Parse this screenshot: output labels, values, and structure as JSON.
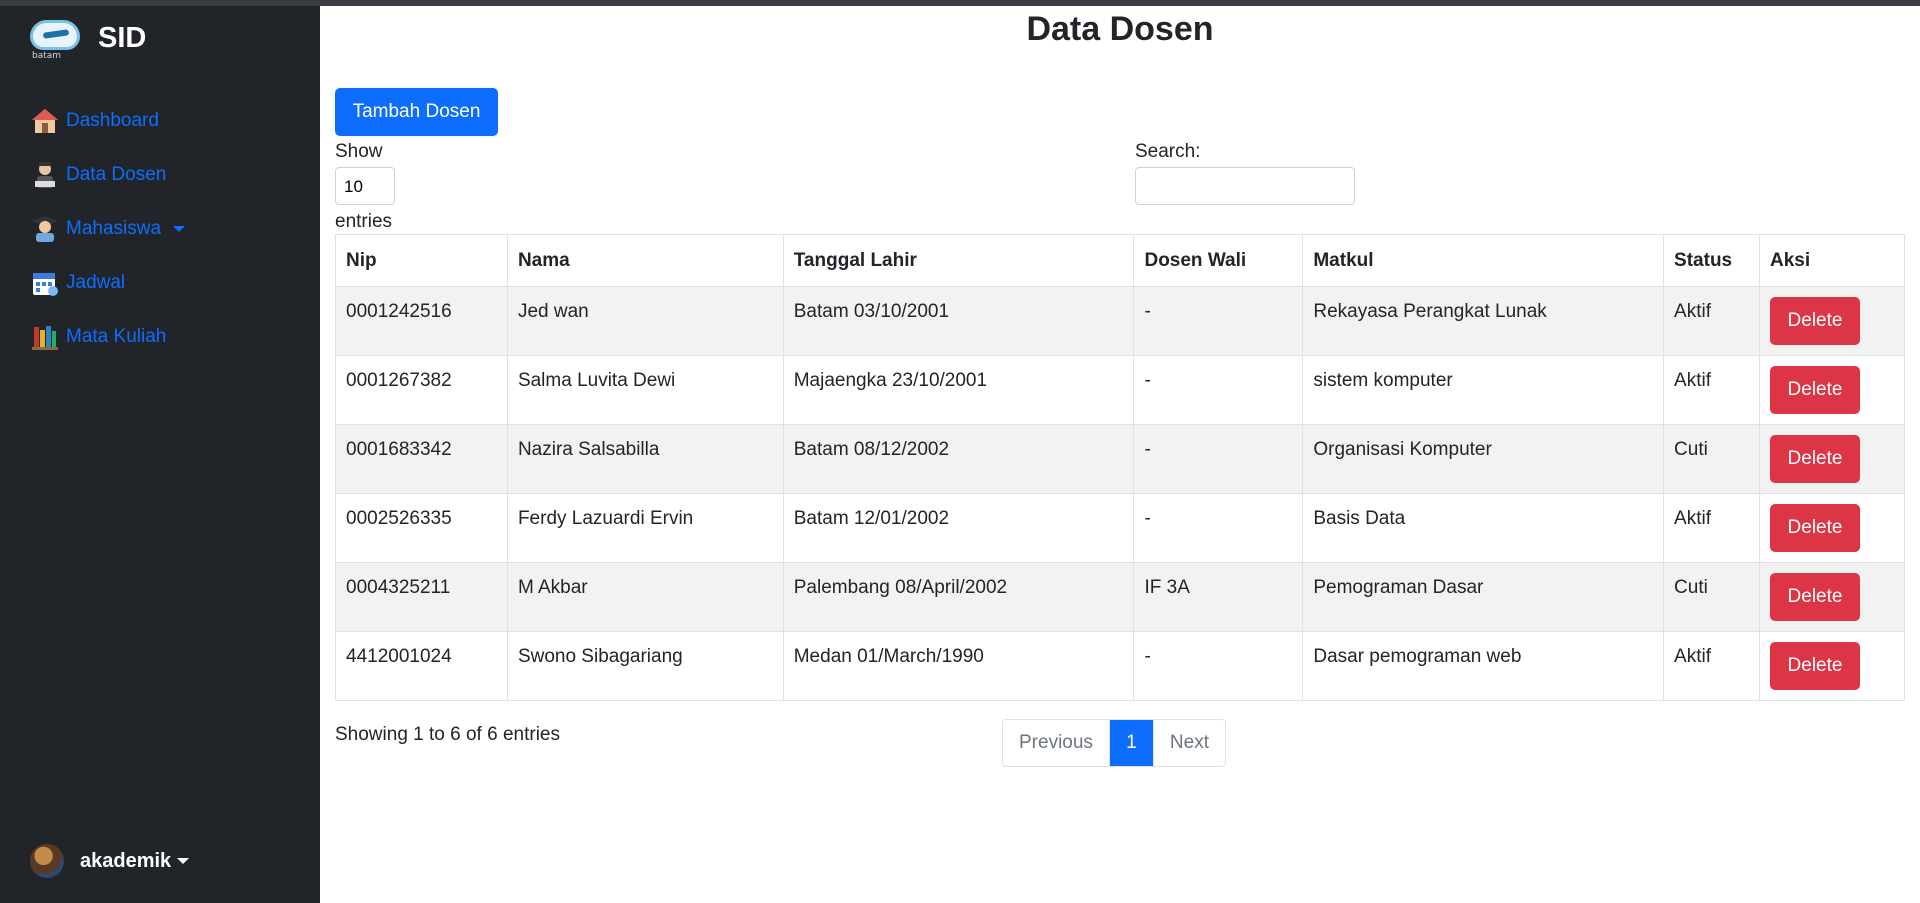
{
  "sidebar": {
    "brand_title": "SID",
    "logo_text": "batam",
    "items": [
      {
        "label": "Dashboard",
        "icon": "house-icon"
      },
      {
        "label": "Data Dosen",
        "icon": "lecturer-icon"
      },
      {
        "label": "Mahasiswa",
        "icon": "student-icon",
        "dropdown": true
      },
      {
        "label": "Jadwal",
        "icon": "calendar-icon"
      },
      {
        "label": "Mata Kuliah",
        "icon": "books-icon"
      }
    ],
    "user_name": "akademik"
  },
  "main": {
    "title": "Data Dosen",
    "add_button": "Tambah Dosen",
    "show_label": "Show",
    "entries_value": "10",
    "entries_label": "entries",
    "search_label": "Search:",
    "search_value": "",
    "columns": [
      "Nip",
      "Nama",
      "Tanggal Lahir",
      "Dosen Wali",
      "Matkul",
      "Status",
      "Aksi"
    ],
    "rows": [
      {
        "nip": "0001242516",
        "nama": "Jed wan",
        "tanggal_lahir": "Batam 03/10/2001",
        "dosen_wali": "-",
        "matkul": "Rekayasa Perangkat Lunak",
        "status": "Aktif",
        "aksi": "Delete"
      },
      {
        "nip": "0001267382",
        "nama": "Salma Luvita Dewi",
        "tanggal_lahir": "Majaengka 23/10/2001",
        "dosen_wali": "-",
        "matkul": "sistem komputer",
        "status": "Aktif",
        "aksi": "Delete"
      },
      {
        "nip": "0001683342",
        "nama": "Nazira Salsabilla",
        "tanggal_lahir": "Batam 08/12/2002",
        "dosen_wali": "-",
        "matkul": "Organisasi Komputer",
        "status": "Cuti",
        "aksi": "Delete"
      },
      {
        "nip": "0002526335",
        "nama": "Ferdy Lazuardi Ervin",
        "tanggal_lahir": "Batam 12/01/2002",
        "dosen_wali": "-",
        "matkul": "Basis Data",
        "status": "Aktif",
        "aksi": "Delete"
      },
      {
        "nip": "0004325211",
        "nama": "M Akbar",
        "tanggal_lahir": "Palembang 08/April/2002",
        "dosen_wali": "IF 3A",
        "matkul": "Pemograman Dasar",
        "status": "Cuti",
        "aksi": "Delete"
      },
      {
        "nip": "4412001024",
        "nama": "Swono Sibagariang",
        "tanggal_lahir": "Medan 01/March/1990",
        "dosen_wali": "-",
        "matkul": "Dasar pemograman web",
        "status": "Aktif",
        "aksi": "Delete"
      }
    ],
    "info_text": "Showing 1 to 6 of 6 entries",
    "pagination": {
      "previous": "Previous",
      "current": "1",
      "next": "Next"
    }
  },
  "colors": {
    "sidebar_bg": "#212529",
    "link": "#0d6efd",
    "primary": "#0d6efd",
    "danger": "#dc3545",
    "stripe": "#f2f2f2"
  }
}
